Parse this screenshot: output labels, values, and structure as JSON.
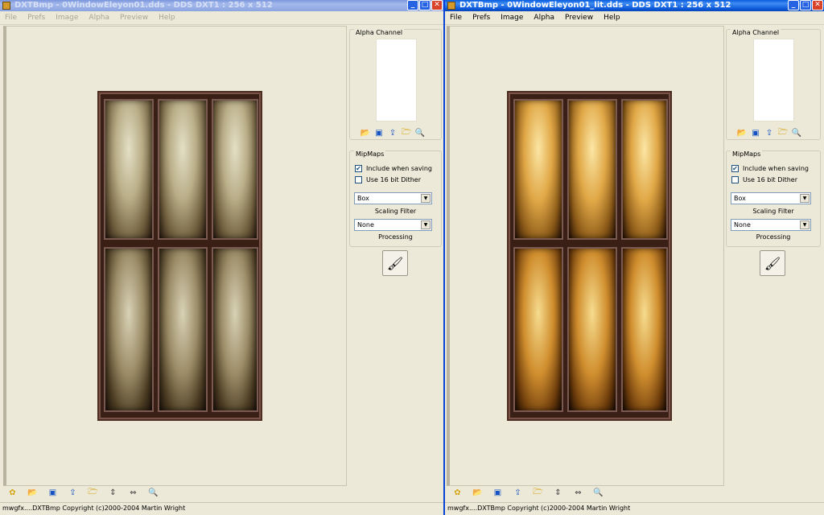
{
  "left": {
    "title": "DXTBmp - 0WindowEleyon01.dds - DDS DXT1 : 256 x 512",
    "menu": [
      "File",
      "Prefs",
      "Image",
      "Alpha",
      "Preview",
      "Help"
    ],
    "alpha_channel": "Alpha Channel",
    "mipmaps": "MipMaps",
    "include_when_saving": "Include when saving",
    "include_checked": true,
    "use_16bit_dither": "Use 16 bit Dither",
    "dither_checked": false,
    "scaling_filter_value": "Box",
    "scaling_filter_label": "Scaling Filter",
    "processing_value": "None",
    "processing_label": "Processing",
    "status": "mwgfx....DXTBmp Copyright (c)2000-2004 Martin Wright"
  },
  "right": {
    "title": "DXTBmp - 0WindowEleyon01_lit.dds - DDS DXT1 : 256 x 512",
    "menu": [
      "File",
      "Prefs",
      "Image",
      "Alpha",
      "Preview",
      "Help"
    ],
    "alpha_channel": "Alpha Channel",
    "mipmaps": "MipMaps",
    "include_when_saving": "Include when saving",
    "include_checked": true,
    "use_16bit_dither": "Use 16 bit Dither",
    "dither_checked": false,
    "scaling_filter_value": "Box",
    "scaling_filter_label": "Scaling Filter",
    "processing_value": "None",
    "processing_label": "Processing",
    "status": "mwgfx....DXTBmp Copyright (c)2000-2004 Martin Wright"
  },
  "icons": {
    "minimize": "0",
    "maximize": "1",
    "close": "r",
    "alpha_buttons": [
      "open-folder-icon",
      "import-icon",
      "export-icon",
      "folder-icon",
      "view-icon"
    ],
    "bottom_buttons": [
      "butterfly-icon",
      "open-folder-icon",
      "import-icon",
      "export-icon",
      "folder-icon",
      "flip-vertical-icon",
      "flip-horizontal-icon",
      "zoom-icon"
    ]
  }
}
